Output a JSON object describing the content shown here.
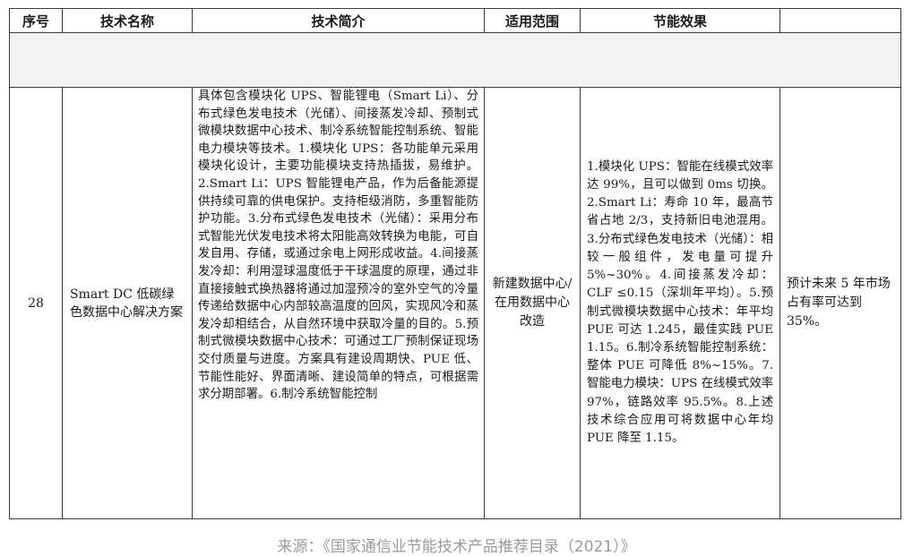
{
  "table": {
    "headers": [
      "序号",
      "技术名称",
      "技术简介",
      "适用范围",
      "节能效果",
      ""
    ],
    "row": {
      "number": "28",
      "name": "Smart DC 低碳绿色数据中心解决方案",
      "description": "具体包含模块化 UPS、智能锂电（Smart Li）、分布式绿色发电技术（光储）、间接蒸发冷却、预制式微模块数据中心技术、制冷系统智能控制系统、智能电力模块等技术。1.模块化 UPS：各功能单元采用模块化设计，主要功能模块支持热插拔，易维护。2.Smart Li：UPS 智能锂电产品，作为后备能源提供持续可靠的供电保护。支持柜级消防，多重智能防护功能。3.分布式绿色发电技术（光储）：采用分布式智能光伏发电技术将太阳能高效转换为电能，可自发自用、存储，或通过余电上网形成收益。4.间接蒸发冷却：利用湿球温度低于干球温度的原理，通过非直接接触式换热器将通过加湿预冷的室外空气的冷量传递给数据中心内部较高温度的回风，实现风冷和蒸发冷却相结合，从自然环境中获取冷量的目的。5.预制式微模块数据中心技术：可通过工厂预制保证现场交付质量与进度。方案具有建设周期快、PUE 低、节能性能好、界面清晰、建设简单的特点，可根据需求分期部署。6.制冷系统智能控制",
      "scope": "新建数据中心/在用数据中心改造",
      "effect": "1.模块化 UPS：智能在线模式效率达 99%，且可以做到 0ms 切换。2.Smart Li：寿命 10 年，最高节省占地 2/3，支持新旧电池混用。3.分布式绿色发电技术（光储）：相较一般组件，发电量可提升 5%~30%。4.间接蒸发冷却：CLF ≤0.15（深圳年平均）。5.预制式微模块数据中心技术：年平均 PUE 可达 1.245，最佳实践 PUE 1.15。6.制冷系统智能控制系统：整体 PUE 可降低 8%~15%。7.智能电力模块：UPS 在线模式效率 97%，链路效率 95.5%。8.上述技术综合应用可将数据中心年均 PUE 降至 1.15。",
      "market": "预计未来 5 年市场占有率可达到 35%。"
    }
  },
  "source_note": "来源：《国家通信业节能技术产品推荐目录（2021）》"
}
